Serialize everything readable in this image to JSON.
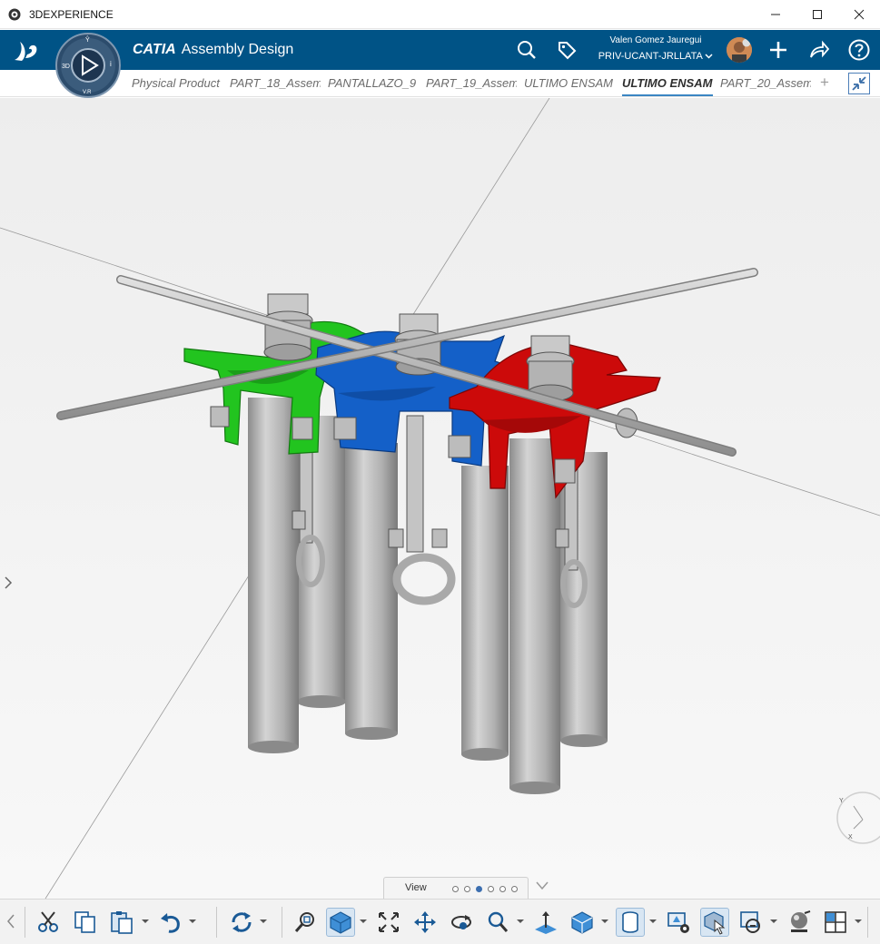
{
  "window": {
    "title": "3DEXPERIENCE"
  },
  "header": {
    "app_brand": "CATIA",
    "app_name": "Assembly Design",
    "compass": {
      "label_left": "3D",
      "label_top": "Ŷ",
      "label_right": "i",
      "label_bottom": "V.R"
    },
    "user": {
      "name": "Valen Gomez Jauregui",
      "tenant": "PRIV-UCANT-JRLLATA"
    },
    "icons": [
      "search-icon",
      "tag-icon",
      "avatar",
      "add-icon",
      "share-icon",
      "help-icon"
    ]
  },
  "tabs": [
    {
      "label": "Physical Product",
      "active": false
    },
    {
      "label": "PART_18_Assem",
      "active": false
    },
    {
      "label": "PANTALLAZO_9",
      "active": false
    },
    {
      "label": "PART_19_Assem",
      "active": false
    },
    {
      "label": "ULTIMO ENSAM",
      "active": false
    },
    {
      "label": "ULTIMO ENSAM",
      "active": true
    },
    {
      "label": "PART_20_Assem",
      "active": false
    }
  ],
  "tab_add": "+",
  "view_section": {
    "label": "View",
    "dots": 6,
    "active_dot": 2
  },
  "compass_axes": {
    "y": "Y",
    "x": "X"
  },
  "colors": {
    "header": "#005386",
    "green": "#22c41f",
    "blue": "#1460c8",
    "red": "#cc0a0a",
    "steel": "#b4b4b4"
  },
  "toolbar": [
    "cut-icon",
    "copy-icon",
    "paste-icon",
    "undo-icon",
    "update-icon",
    "zoom-area-icon",
    "view-mode-icon",
    "fit-all-icon",
    "pan-icon",
    "rotate-icon",
    "zoom-icon",
    "normal-view-icon",
    "shading-icon",
    "cylinder-icon",
    "render-settings-icon",
    "select-3d-icon",
    "section-icon",
    "material-icon",
    "split-view-icon"
  ]
}
